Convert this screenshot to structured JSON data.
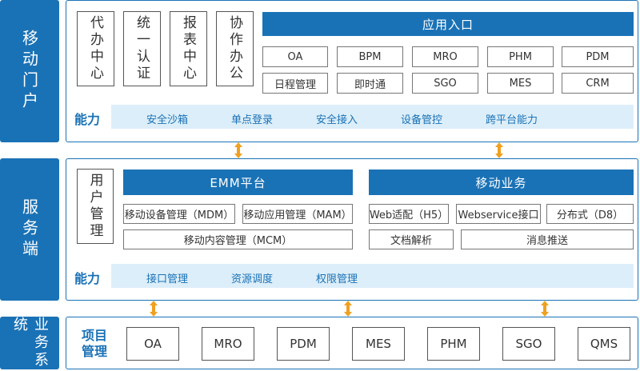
{
  "tiers": {
    "mobile_portal": "移动门户",
    "server": "服务端",
    "business": "业务系统"
  },
  "portal": {
    "vertical_boxes": [
      "代办中心",
      "统一认证",
      "报表中心",
      "协作办公"
    ],
    "app_entry_title": "应用入口",
    "app_entry_row1": [
      "OA",
      "BPM",
      "MRO",
      "PHM",
      "PDM"
    ],
    "app_entry_row2": [
      "日程管理",
      "即时通",
      "SGO",
      "MES",
      "CRM"
    ],
    "capability_title": "能力",
    "capabilities": [
      "安全沙箱",
      "单点登录",
      "安全接入",
      "设备管控",
      "跨平台能力"
    ]
  },
  "server": {
    "user_mgmt": "用户管理",
    "emm_title": "EMM平台",
    "emm_row1": [
      "移动设备管理（MDM）",
      "移动应用管理（MAM）"
    ],
    "emm_row2": "移动内容管理（MCM）",
    "mobile_biz_title": "移动业务",
    "mobile_biz_row1": [
      "Web适配（H5）",
      "Webservice接口",
      "分布式（D8）"
    ],
    "mobile_biz_row2": [
      "文档解析",
      "消息推送"
    ],
    "capability_title": "能力",
    "capabilities": [
      "接口管理",
      "资源调度",
      "权限管理"
    ]
  },
  "business": {
    "project_title": "项目管理",
    "systems": [
      "OA",
      "MRO",
      "PDM",
      "MES",
      "PHM",
      "SGO",
      "QMS"
    ]
  },
  "colors": {
    "primary_blue": "#1a72b6",
    "light_blue": "#dceef9",
    "arrow_orange": "#f0a020"
  }
}
